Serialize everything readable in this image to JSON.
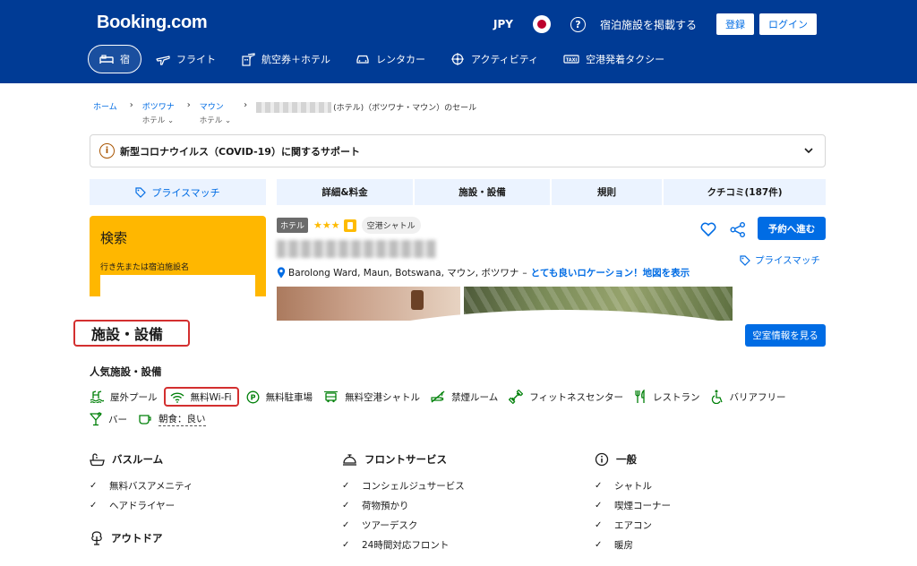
{
  "header": {
    "logo": "Booking.com",
    "currency": "JPY",
    "help": "?",
    "list_property": "宿泊施設を掲載する",
    "register": "登録",
    "login": "ログイン"
  },
  "nav": [
    {
      "label": "宿",
      "icon": "bed-icon",
      "active": true
    },
    {
      "label": "フライト",
      "icon": "plane-icon"
    },
    {
      "label": "航空券＋ホテル",
      "icon": "plane-hotel-icon"
    },
    {
      "label": "レンタカー",
      "icon": "car-icon"
    },
    {
      "label": "アクティビティ",
      "icon": "attractions-icon"
    },
    {
      "label": "空港発着タクシー",
      "icon": "taxi-icon"
    }
  ],
  "breadcrumb": {
    "home": "ホーム",
    "country": "ボツワナ",
    "country_sub": "ホテル",
    "city": "マウン",
    "city_sub": "ホテル",
    "current": "(ホテル)（ボツワナ・マウン）のセール"
  },
  "covid": {
    "icon": "i",
    "text": "新型コロナウイルス（COVID-19）に関するサポート"
  },
  "tabs": {
    "price_match": "プライスマッチ",
    "items": [
      "詳細&料金",
      "施設・設備",
      "規則",
      "クチコミ(187件)"
    ]
  },
  "search": {
    "title": "検索",
    "label": "行き先または宿泊施設名"
  },
  "property": {
    "type_badge": "ホテル",
    "stars": "★★★",
    "shuttle_badge": "空港シャトル",
    "address": "Barolong Ward, Maun, Botswana, マウン, ボツワナ",
    "address_sep": "–",
    "address_link": "とても良いロケーション！地図を表示",
    "reserve_button": "予約へ進む",
    "price_match_link": "プライスマッチ"
  },
  "facilities": {
    "title": "施設・設備",
    "availability_button": "空室情報を見る",
    "popular_title": "人気施設・設備",
    "popular": [
      {
        "label": "屋外プール",
        "icon": "pool-icon"
      },
      {
        "label": "無料Wi-Fi",
        "icon": "wifi-icon",
        "highlight": true
      },
      {
        "label": "無料駐車場",
        "icon": "parking-icon"
      },
      {
        "label": "無料空港シャトル",
        "icon": "shuttle-icon"
      },
      {
        "label": "禁煙ルーム",
        "icon": "no-smoking-icon"
      },
      {
        "label": "フィットネスセンター",
        "icon": "fitness-icon"
      },
      {
        "label": "レストラン",
        "icon": "restaurant-icon"
      },
      {
        "label": "バリアフリー",
        "icon": "accessible-icon"
      },
      {
        "label": "バー",
        "icon": "bar-icon"
      },
      {
        "label": "朝食：良い",
        "icon": "breakfast-icon"
      }
    ],
    "columns": [
      {
        "title": "バスルーム",
        "icon": "bath-icon",
        "items": [
          "無料バスアメニティ",
          "ヘアドライヤー"
        ]
      },
      {
        "title": "フロントサービス",
        "icon": "reception-icon",
        "items": [
          "コンシェルジュサービス",
          "荷物預かり",
          "ツアーデスク",
          "24時間対応フロント"
        ]
      },
      {
        "title": "一般",
        "icon": "info-icon",
        "items": [
          "シャトル",
          "喫煙コーナー",
          "エアコン",
          "暖房"
        ]
      }
    ],
    "outdoor_title": "アウトドア",
    "check": "✓"
  }
}
